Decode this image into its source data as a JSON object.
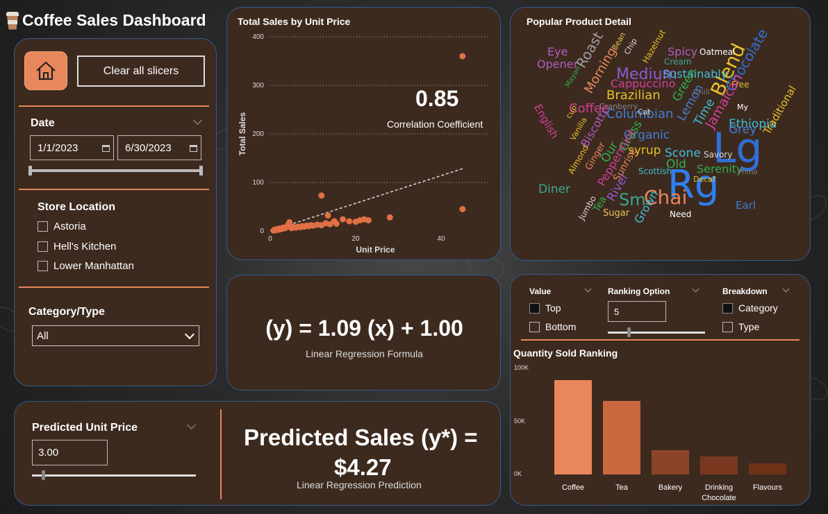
{
  "app": {
    "title": "Coffee Sales Dashboard"
  },
  "filters": {
    "clear_label": "Clear all slicers",
    "date": {
      "label": "Date",
      "start": "1/1/2023",
      "end": "6/30/2023"
    },
    "store": {
      "label": "Store Location",
      "options": [
        "Astoria",
        "Hell's Kitchen",
        "Lower Manhattan"
      ]
    },
    "category": {
      "label": "Category/Type",
      "selected": "All"
    }
  },
  "scatter": {
    "title": "Total Sales by Unit Price",
    "correlation_value": "0.85",
    "correlation_label": "Correlation Coefficient"
  },
  "regression": {
    "formula": "(y) = 1.09 (x) + 1.00",
    "formula_label": "Linear Regression Formula"
  },
  "prediction": {
    "input_label": "Predicted Unit Price",
    "input_value": "3.00",
    "result_text": "Predicted Sales (y*) =",
    "result_value": "$4.27",
    "result_label": "Linear Regression Prediction",
    "slider_level": 0.06
  },
  "wordcloud": {
    "title": "Popular Product Detail"
  },
  "ranking": {
    "value_label": "Value",
    "value_options": [
      "Top",
      "Bottom"
    ],
    "option_label": "Ranking Option",
    "option_value": "5",
    "option_slider_level": 0.2,
    "breakdown_label": "Breakdown",
    "breakdown_options": [
      "Category",
      "Type"
    ],
    "chart_title": "Quantity Sold Ranking"
  },
  "chart_data": [
    {
      "type": "scatter",
      "title": "Total Sales by Unit Price",
      "xlabel": "Unit Price",
      "ylabel": "Total Sales",
      "xlim": [
        0,
        46
      ],
      "ylim": [
        0,
        400
      ],
      "xticks": [
        0,
        20,
        40
      ],
      "yticks": [
        0,
        100,
        200,
        300,
        400
      ],
      "points": [
        [
          0.8,
          1
        ],
        [
          1,
          2
        ],
        [
          1.2,
          3
        ],
        [
          1.5,
          2
        ],
        [
          1.8,
          4
        ],
        [
          2,
          3
        ],
        [
          2.2,
          5
        ],
        [
          2.5,
          4
        ],
        [
          2.8,
          6
        ],
        [
          3,
          5
        ],
        [
          3.2,
          7
        ],
        [
          3.5,
          6
        ],
        [
          3.8,
          8
        ],
        [
          4,
          9
        ],
        [
          4.2,
          13
        ],
        [
          4.5,
          18
        ],
        [
          4.8,
          10
        ],
        [
          5,
          6
        ],
        [
          5.5,
          8
        ],
        [
          6,
          7
        ],
        [
          6.5,
          9
        ],
        [
          7,
          8
        ],
        [
          7.5,
          10
        ],
        [
          8,
          9
        ],
        [
          8.5,
          11
        ],
        [
          9,
          10
        ],
        [
          9.5,
          12
        ],
        [
          10,
          11
        ],
        [
          11,
          13
        ],
        [
          12,
          12
        ],
        [
          12,
          73
        ],
        [
          13,
          16
        ],
        [
          13.5,
          32
        ],
        [
          14,
          14
        ],
        [
          15,
          20
        ],
        [
          15.5,
          15
        ],
        [
          17,
          24
        ],
        [
          18.5,
          20
        ],
        [
          20,
          19
        ],
        [
          21,
          22
        ],
        [
          22,
          24
        ],
        [
          23,
          22
        ],
        [
          28,
          28
        ],
        [
          45,
          45
        ],
        [
          45,
          360
        ]
      ],
      "trendline": {
        "slope": 2.85,
        "intercept": 0,
        "x_range": [
          0,
          45
        ]
      },
      "grid": true
    },
    {
      "type": "bar",
      "title": "Quantity Sold Ranking",
      "categories": [
        "Coffee",
        "Tea",
        "Bakery",
        "Drinking Chocolate",
        "Flavours"
      ],
      "values": [
        89000,
        69000,
        23000,
        17000,
        10500
      ],
      "ylim": [
        0,
        100000
      ],
      "yticks": [
        "0K",
        "50K",
        "100K"
      ],
      "colors": [
        "#e8875c",
        "#c9683e",
        "#8c4428",
        "#7a3720",
        "#6e3118"
      ]
    }
  ],
  "words": [
    {
      "t": "Lg",
      "c": "#2f6fd6"
    },
    {
      "t": "Rg",
      "c": "#2f7ff0"
    },
    {
      "t": "Blend",
      "c": "#e7c02a"
    },
    {
      "t": "Chai",
      "c": "#e8875c"
    },
    {
      "t": "Sm",
      "c": "#3aa890"
    },
    {
      "t": "Medium",
      "c": "#8e5bd1"
    },
    {
      "t": "Roast",
      "c": "#a0a0a0"
    },
    {
      "t": "Eye",
      "c": "#b05fc0"
    },
    {
      "t": "Opener",
      "c": "#b05fc0"
    },
    {
      "t": "Bean",
      "c": "#e8c35c"
    },
    {
      "t": "Chip",
      "c": "#d9d9d9"
    },
    {
      "t": "Hazelnut",
      "c": "#e7c02a"
    },
    {
      "t": "Spicy",
      "c": "#b05fc0"
    },
    {
      "t": "Cream",
      "c": "#3aa890"
    },
    {
      "t": "Oatmeal",
      "c": "#ffffff"
    },
    {
      "t": "Chocolate",
      "c": "#2f6fd6"
    },
    {
      "t": "Sustainably",
      "c": "#3fbfd6"
    },
    {
      "t": "Free",
      "c": "#e7c02a"
    },
    {
      "t": "Morning",
      "c": "#e8875c"
    },
    {
      "t": "Cappuccino",
      "c": "#d13f9b"
    },
    {
      "t": "Brazilian",
      "c": "#e7c02a"
    },
    {
      "t": "Green",
      "c": "#2fae4c"
    },
    {
      "t": "Chili",
      "c": "#777777"
    },
    {
      "t": "English",
      "c": "#d13f9b"
    },
    {
      "t": "Coffee",
      "c": "#d13f9b"
    },
    {
      "t": "Columbian",
      "c": "#3f7fd6"
    },
    {
      "t": "Ethiopia",
      "c": "#3fbfd6"
    },
    {
      "t": "Grey",
      "c": "#3f7fd6"
    },
    {
      "t": "Traditional",
      "c": "#e7c02a"
    },
    {
      "t": "Lemon",
      "c": "#3f7fd6"
    },
    {
      "t": "Time",
      "c": "#3fbfd6"
    },
    {
      "t": "Jamaican",
      "c": "#d13f9b"
    },
    {
      "t": "Organic",
      "c": "#3f7fd6"
    },
    {
      "t": "Grass",
      "c": "#2fae4c"
    },
    {
      "t": "Biscotti",
      "c": "#b05fc0"
    },
    {
      "t": "syrup",
      "c": "#e7c02a"
    },
    {
      "t": "Scone",
      "c": "#3fbfd6"
    },
    {
      "t": "Savory",
      "c": "#d9d9d9"
    },
    {
      "t": "Old",
      "c": "#2fae4c"
    },
    {
      "t": "Serenity",
      "c": "#2fae4c"
    },
    {
      "t": "Vanilla",
      "c": "#e7c02a"
    },
    {
      "t": "Almond",
      "c": "#e7c02a"
    },
    {
      "t": "Ginger",
      "c": "#e8875c"
    },
    {
      "t": "Peppermint",
      "c": "#d13f9b"
    },
    {
      "t": "Sunrise",
      "c": "#e8875c"
    },
    {
      "t": "Scottish",
      "c": "#3fbfd6"
    },
    {
      "t": "Diner",
      "c": "#3aa890"
    },
    {
      "t": "River",
      "c": "#8e5bd1"
    },
    {
      "t": "Earl",
      "c": "#3f7fd6"
    },
    {
      "t": "Decaf",
      "c": "#e7c02a"
    },
    {
      "t": "Tea",
      "c": "#2fae4c"
    },
    {
      "t": "Sugar",
      "c": "#e8c35c"
    },
    {
      "t": "Jumbo",
      "c": "#d9d9d9"
    },
    {
      "t": "Grown",
      "c": "#3fbfd6"
    },
    {
      "t": "Need",
      "c": "#ffffff"
    },
    {
      "t": "Our",
      "c": "#2fae4c"
    },
    {
      "t": "My",
      "c": "#ffffff"
    },
    {
      "t": "cup",
      "c": "#e7c02a"
    },
    {
      "t": "Mayan",
      "c": "#2fae4c"
    },
    {
      "t": "Cranberry",
      "c": "#888888"
    },
    {
      "t": "Cat",
      "c": "#d9d9d9"
    },
    {
      "t": "Primo",
      "c": "#888888"
    }
  ]
}
